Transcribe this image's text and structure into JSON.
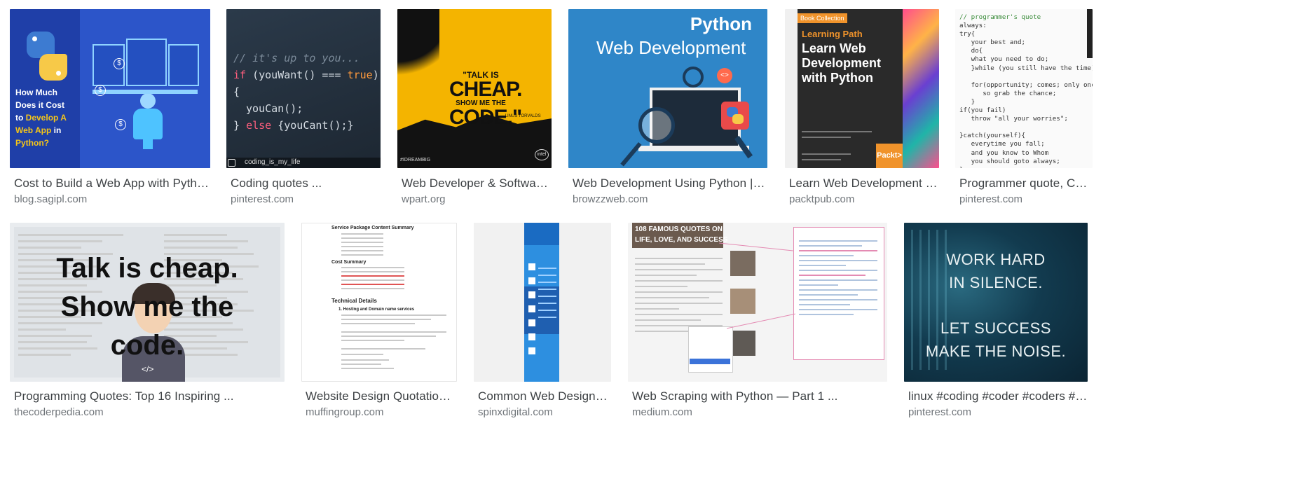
{
  "results": [
    {
      "title": "Cost to Build a Web App with Python ...",
      "source": "blog.sagipl.com",
      "image": {
        "text": {
          "line1": "How Much",
          "line2": "Does it Cost",
          "line3": "to ",
          "line3b": "Develop A",
          "line4": "Web App",
          "line4b": " in",
          "line5": "Python?"
        }
      }
    },
    {
      "title": "Coding quotes ...",
      "source": "pinterest.com",
      "image": {
        "text": {
          "comment": "// it's up to you...",
          "l2a": "if",
          "l2b": " (youWant() === ",
          "l2c": "true",
          "l2d": ") {",
          "l3": "youCan();",
          "l4a": "} ",
          "l4b": "else",
          "l4c": " {youCant();}",
          "tag": "coding_is_my_life"
        }
      }
    },
    {
      "title": "Web Developer & Software P...",
      "source": "wpart.org",
      "image": {
        "text": {
          "t1": "\"TALK IS",
          "t2": "CHEAP.",
          "t3": "SHOW ME THE",
          "t4": "CODE.\"",
          "author": "- LINUS TORVALDS",
          "brand": "#IDREAMBIG",
          "chip": "intel"
        }
      }
    },
    {
      "title": "Web Development Using Python | BRO...",
      "source": "browzzweb.com",
      "image": {
        "text": {
          "h1": "Python",
          "h2": "Web Development"
        }
      }
    },
    {
      "title": "Learn Web Development wit...",
      "source": "packtpub.com",
      "image": {
        "text": {
          "badge": "Book Collection",
          "path": "Learning Path",
          "b1": "Learn Web",
          "b2": "Development",
          "b3": "with Python",
          "publisher": "Packt>"
        }
      }
    },
    {
      "title": "Programmer quote, Codi...",
      "source": "pinterest.com",
      "image": {
        "text": {
          "code": [
            "// programmer's quote",
            "always:",
            "try{",
            "   your best and;",
            "   do{",
            "   what you need to do;",
            "   }while (you still have the time);",
            "",
            "   for(opportunity; comes; only once){",
            "      so grab the chance;",
            "   }",
            "if(you fail)",
            "   throw \"all your worries\";",
            "",
            "}catch(yourself){",
            "   everytime you fall;",
            "   and you know to Whom",
            "   you should goto always;",
            "}"
          ]
        }
      }
    },
    {
      "title": "Programming Quotes: Top 16 Inspiring ...",
      "source": "thecoderpedia.com",
      "image": {
        "text": {
          "q1": "Talk is cheap.",
          "q2": "Show me the",
          "q3": "code.",
          "tag": "</>"
        }
      }
    },
    {
      "title": "Website Design Quotation T...",
      "source": "muffingroup.com",
      "image": {
        "text": {
          "s1": "Service Package Content Summary",
          "s2": "Cost Summary",
          "s3": "Technical Details",
          "s4": "1. Hosting and Domain name services"
        }
      }
    },
    {
      "title": "Common Web Design La...",
      "source": "spinxdigital.com",
      "image": {}
    },
    {
      "title": "Web Scraping with Python — Part 1 ...",
      "source": "medium.com",
      "image": {
        "text": {
          "banner1": "108 FAMOUS QUOTES ON",
          "banner2": "LIFE, LOVE, AND SUCCESS"
        }
      }
    },
    {
      "title": "linux #coding #coder #coders #ph...",
      "source": "pinterest.com",
      "image": {
        "text": {
          "w1": "WORK HARD",
          "w2": "IN SILENCE.",
          "w3": "LET SUCCESS",
          "w4": "MAKE THE NOISE."
        }
      }
    }
  ],
  "colors": {
    "title": "#3c4043",
    "source": "#70757a",
    "python_blue": "#2a4db5",
    "python_yellow": "#f5c518",
    "wpart_yellow": "#f4b400",
    "browzz_blue": "#2f86c8",
    "packt_orange": "#f0932b"
  }
}
